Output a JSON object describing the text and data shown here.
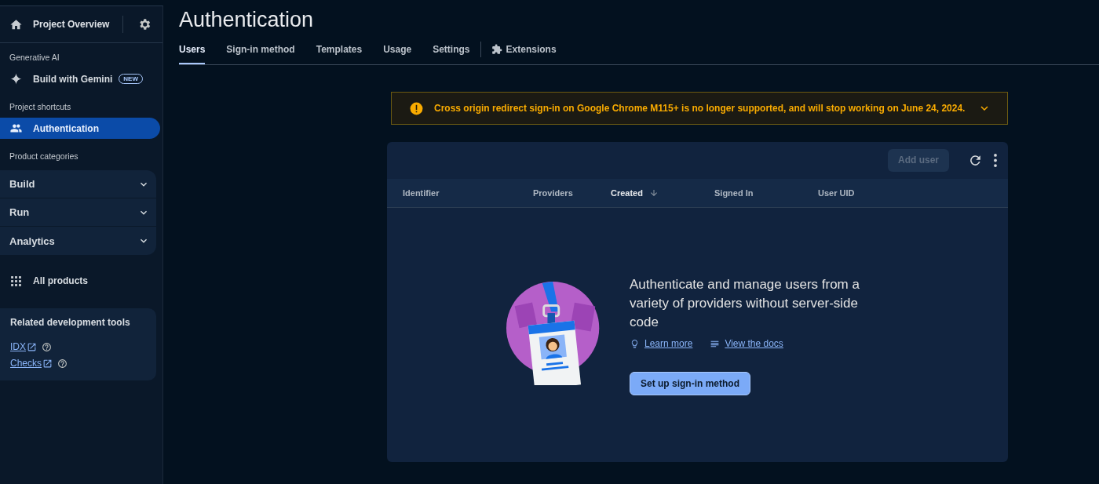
{
  "sidebar": {
    "overview": "Project Overview",
    "groups": [
      {
        "heading": "Generative AI",
        "items": [
          {
            "label": "Build with Gemini",
            "kind": "gemini",
            "badge": "NEW",
            "selected": false
          }
        ]
      },
      {
        "heading": "Project shortcuts",
        "items": [
          {
            "label": "Authentication",
            "kind": "auth",
            "selected": true
          }
        ]
      }
    ],
    "categories_heading": "Product categories",
    "categories": [
      {
        "label": "Build",
        "expanded": false
      },
      {
        "label": "Run",
        "expanded": false
      },
      {
        "label": "Analytics",
        "expanded": false
      }
    ],
    "all_products": "All products",
    "related": {
      "title": "Related development tools",
      "links": [
        {
          "label": "IDX"
        },
        {
          "label": "Checks"
        }
      ]
    }
  },
  "main": {
    "title": "Authentication",
    "tabs": [
      {
        "label": "Users",
        "selected": true,
        "kind": "page"
      },
      {
        "label": "Sign-in method",
        "selected": false,
        "kind": "page"
      },
      {
        "label": "Templates",
        "selected": false,
        "kind": "page"
      },
      {
        "label": "Usage",
        "selected": false,
        "kind": "page"
      },
      {
        "label": "Settings",
        "selected": false,
        "kind": "page"
      },
      {
        "label": "Extensions",
        "selected": false,
        "kind": "extensions"
      }
    ],
    "banner": {
      "text": "Cross origin redirect sign-in on Google Chrome M115+ is no longer supported, and will stop working on June 24, 2024.",
      "expanded": false
    },
    "table": {
      "add_user": {
        "label": "Add user",
        "disabled": true
      },
      "columns": [
        {
          "label": "Identifier",
          "sorted": false
        },
        {
          "label": "Providers",
          "sorted": false
        },
        {
          "label": "Created",
          "sorted": true
        },
        {
          "label": "Signed In",
          "sorted": false
        },
        {
          "label": "User UID",
          "sorted": false
        }
      ],
      "empty": {
        "message": "Authenticate and manage users from a variety of providers without server-side code",
        "links": [
          {
            "label": "Learn more",
            "kind": "learn"
          },
          {
            "label": "View the docs",
            "kind": "docs"
          }
        ],
        "button": "Set up sign-in method"
      }
    }
  }
}
